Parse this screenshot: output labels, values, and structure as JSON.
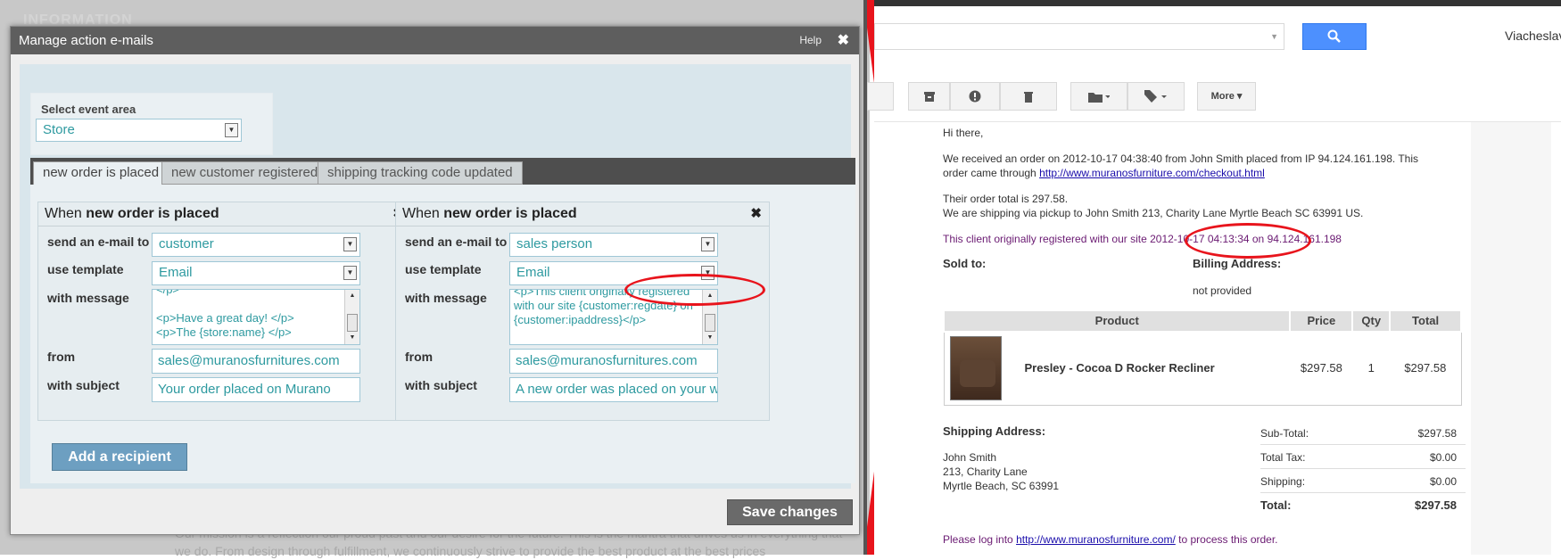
{
  "background": {
    "section_heading": "INFORMATION",
    "mission_text": "Our mission is a reflection our proud past and our desire for the future. This is the mantra that drives us in everything that we do. From design through fulfillment, we continuously strive to provide the best product at the best prices"
  },
  "dialog": {
    "title": "Manage action e-mails",
    "help_label": "Help",
    "close_glyph": "✖",
    "event_area": {
      "label": "Select event area",
      "value": "Store"
    },
    "tabs": [
      {
        "label": "new order is placed",
        "active": true
      },
      {
        "label": "new customer registered",
        "active": false
      },
      {
        "label": "shipping tracking code updated",
        "active": false
      }
    ],
    "cards": [
      {
        "title_prefix": "When ",
        "title_event": "new order is placed",
        "close_glyph": "✖",
        "send_label": "send an e-mail to",
        "send_value": "customer",
        "template_label": "use template",
        "template_value": "Email",
        "message_label": "with message",
        "message_lines": [
          "</p>",
          "",
          "<p>Have a great day! </p>",
          "<p>The {store:name} </p>"
        ],
        "from_label": "from",
        "from_value": "sales@muranosfurnitures.com",
        "subject_label": "with subject",
        "subject_value": "Your order placed on Murano"
      },
      {
        "title_prefix": "When ",
        "title_event": "new order is placed",
        "close_glyph": "✖",
        "send_label": "send an e-mail to",
        "send_value": "sales person",
        "template_label": "use template",
        "template_value": "Email",
        "message_label": "with message",
        "message_lines": [
          "<p>This client originally registered",
          "with our site {customer:regdate} on",
          "{customer:ipaddress}</p>"
        ],
        "from_label": "from",
        "from_value": "sales@muranosfurnitures.com",
        "subject_label": "with subject",
        "subject_value": "A new order was placed on your websit"
      }
    ],
    "add_recipient_label": "Add a recipient",
    "save_label": "Save changes"
  },
  "gmail": {
    "user_name": "Viacheslav",
    "toolbar": {
      "more_label": "More ▾"
    },
    "icons": [
      "archive-icon",
      "report-spam-icon",
      "delete-icon",
      "move-to-folder-icon",
      "labels-icon"
    ]
  },
  "email": {
    "greeting": "Hi there,",
    "order_line_1": "We received an order on 2012-10-17 04:38:40 from John Smith placed from IP 94.124.161.198. This",
    "order_line_2_prefix": "order came through ",
    "checkout_link": "http://www.muranosfurniture.com/checkout.html",
    "total_line": "Their order total is 297.58.",
    "shipping_line": "We are shipping via pickup to John Smith 213, Charity Lane Myrtle Beach SC 63991 US.",
    "registered_prefix": "This client originally registered with our site ",
    "registered_date": "2012-10-17 04:13:34",
    "registered_on": " on ",
    "registered_ip": "94.124.161.198",
    "sold_to_label": "Sold to:",
    "billing_label": "Billing Address:",
    "billing_value": "not provided",
    "table_headers": [
      "Product",
      "Price",
      "Qty",
      "Total"
    ],
    "product": {
      "name": "Presley - Cocoa D Rocker Recliner",
      "price": "$297.58",
      "qty": "1",
      "total": "$297.58"
    },
    "shipping_address_label": "Shipping Address:",
    "shipping_address_lines": [
      "John Smith",
      "213, Charity Lane",
      "Myrtle Beach, SC 63991"
    ],
    "totals": [
      {
        "label": "Sub-Total:",
        "value": "$297.58"
      },
      {
        "label": "Total Tax:",
        "value": "$0.00"
      },
      {
        "label": "Shipping:",
        "value": "$0.00"
      },
      {
        "label": "Total:",
        "value": "$297.58"
      }
    ],
    "footer_prefix": "Please log into ",
    "footer_link": "http://www.muranosfurniture.com/",
    "footer_suffix": " to process this order."
  },
  "colors": {
    "annotation_red": "#e8141c",
    "dialog_title_bg": "#5e5e5e",
    "input_text": "#2e9aa0",
    "gmail_blue": "#4d90fe"
  }
}
